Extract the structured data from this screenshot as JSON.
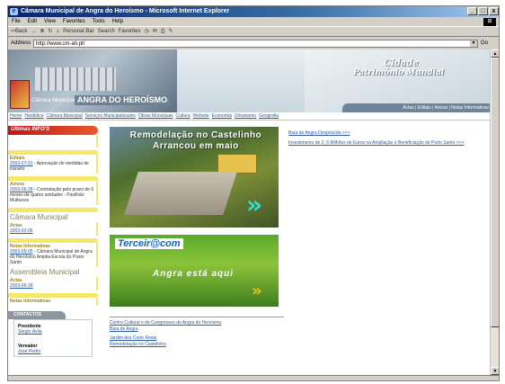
{
  "window": {
    "title": "Câmara Municipal de Angra do Heroísmo - Microsoft Internet Explorer",
    "buttons": [
      "_",
      "□",
      "x"
    ]
  },
  "menu": [
    "File",
    "Edit",
    "View",
    "Favorites",
    "Tools",
    "Help"
  ],
  "toolbar": {
    "back": "⇦Back",
    "personal_bar": "Personal Bar",
    "search": "Search",
    "favorites": "Favorites"
  },
  "address": {
    "label": "Address",
    "url": "http://www.cm-ah.pt/",
    "go": "Go"
  },
  "header": {
    "camara_label": "Câmara Municipal",
    "city_name": "ANGRA DO HEROÍSMO",
    "cidade": "Cidade",
    "patrimonio": "Património Mundial",
    "top_links": "Actas | Editais | Avisos | Notas Informativas"
  },
  "nav": [
    "Home",
    "Heráldica",
    "Câmara Municipal",
    "Serviços Municipalizados",
    "Obras Municipais",
    "Cultura",
    "Website",
    "Economia",
    "Urbanismo",
    "Geografia"
  ],
  "left": {
    "ultimas": "Últimas INFO'S",
    "editais_title": "Editais",
    "editais_link": "2003-07-01",
    "editais_text": "- Aprovação de medidas de trânsito",
    "avisos_title": "Avisos",
    "avisos_link": "2003-06-28",
    "avisos_text": "- Contratação pelo prazo de 6 meses de quatro unidades - Pavilhão Multiusos",
    "camara_section": "Câmara Municipal",
    "camara_actas": "Actas",
    "camara_actas_date": "2003-02-05",
    "notas_title": "Notas Informativas",
    "notas_link": "2003-05-05",
    "notas_text": "- Câmara Municipal de Angra do Heroísmo Amplia Escola do Posto Santo",
    "assembleia_section": "Assembleia Municipal",
    "assembleia_actas": "Actas",
    "assembleia_actas_date": "2003-06-28",
    "notas2_title": "Notas Informativas",
    "contactos": "CONTACTOS",
    "presidente_role": "Presidente",
    "presidente_name": "Sérgio Ávila",
    "vereador_role": "Vereador",
    "vereador_name": "José Pedro"
  },
  "center": {
    "banner1_line1": "Remodelação no Castelinho",
    "banner1_line2": "Arrancou em maio",
    "banner2_logo": "Terceir@com",
    "banner2_tag": "Angra está aqui",
    "links": [
      "Centro Cultural e de Congressos de Angra do Heroísmo",
      "Baía de Angra",
      "Jardim dos Corte Reais",
      "Remodelação no Castelinho"
    ]
  },
  "right": {
    "links": [
      "Baía de Angra Despoluída >>>",
      "Investimento de 2, 6 Milhões de Euros na Ampliação e Beneficiação do Porto Santo >>>"
    ]
  }
}
